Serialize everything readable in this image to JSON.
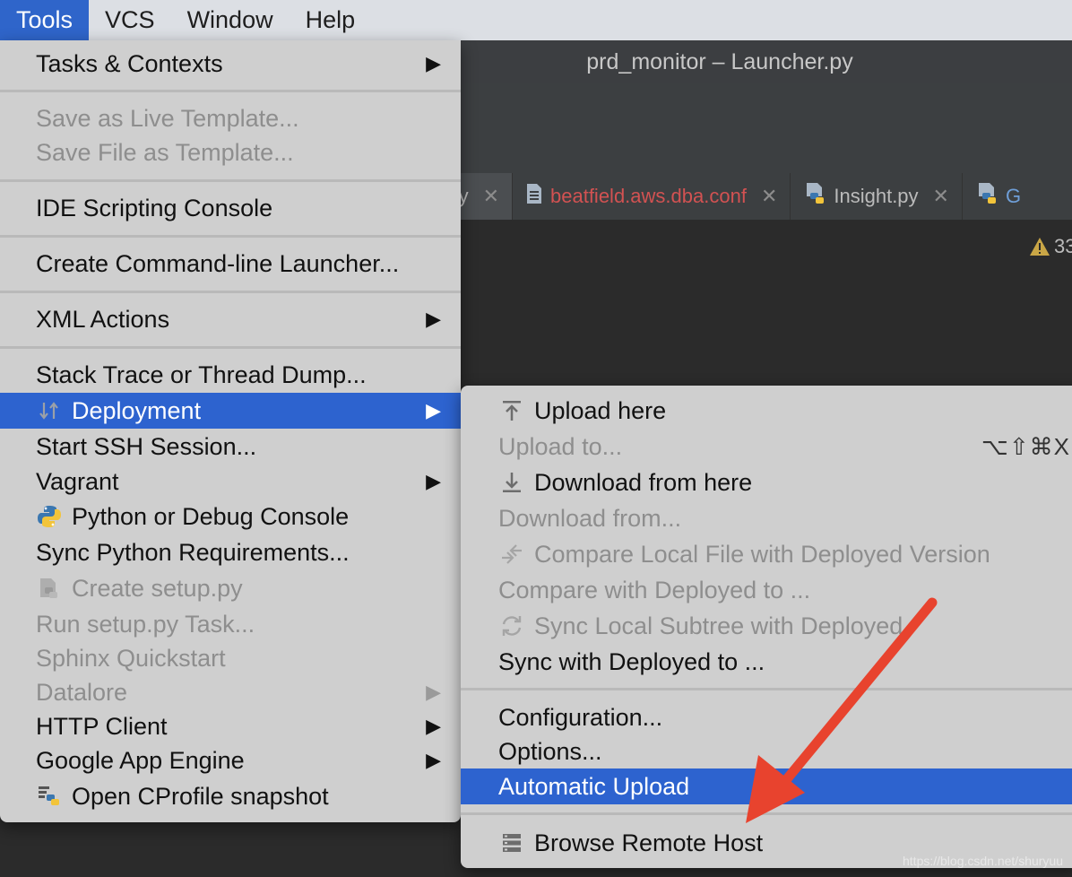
{
  "menubar": {
    "items": [
      {
        "label": "Tools"
      },
      {
        "label": "VCS"
      },
      {
        "label": "Window"
      },
      {
        "label": "Help"
      }
    ]
  },
  "ide": {
    "window_title": "prd_monitor – Launcher.py",
    "tabs": [
      {
        "label": "y"
      },
      {
        "label": "beatfield.aws.dba.conf"
      },
      {
        "label": "Insight.py"
      },
      {
        "label": "G"
      }
    ],
    "tab_close": "✕",
    "warning_count": "33"
  },
  "tools_menu": {
    "items": {
      "tasks": "Tasks & Contexts",
      "save_live": "Save as Live Template...",
      "save_file": "Save File as Template...",
      "ide_console": "IDE Scripting Console",
      "cmd_launcher": "Create Command-line Launcher...",
      "xml": "XML Actions",
      "stack_trace": "Stack Trace or Thread Dump...",
      "deployment": "Deployment",
      "ssh": "Start SSH Session...",
      "vagrant": "Vagrant",
      "python_console": "Python or Debug Console",
      "sync_req": "Sync Python Requirements...",
      "create_setup": "Create setup.py",
      "run_setup": "Run setup.py Task...",
      "sphinx": "Sphinx Quickstart",
      "datalore": "Datalore",
      "http_client": "HTTP Client",
      "gae": "Google App Engine",
      "cprofile": "Open CProfile snapshot"
    },
    "submenu_arrow": "▶"
  },
  "deployment_menu": {
    "items": {
      "upload_here": "Upload here",
      "upload_to": "Upload to...",
      "upload_to_shortcut": "⌥⇧⌘X",
      "download_here": "Download from here",
      "download_from": "Download from...",
      "compare_local": "Compare Local File with Deployed Version",
      "compare_with": "Compare with Deployed to ...",
      "sync_subtree": "Sync Local Subtree with Deployed",
      "sync_with": "Sync with Deployed to ...",
      "configuration": "Configuration...",
      "options": "Options...",
      "auto_upload": "Automatic Upload",
      "browse_remote": "Browse Remote Host"
    }
  },
  "watermark": "https://blog.csdn.net/shuryuu",
  "colors": {
    "selection": "#2d63cf",
    "annotation_arrow": "#e8432e"
  }
}
